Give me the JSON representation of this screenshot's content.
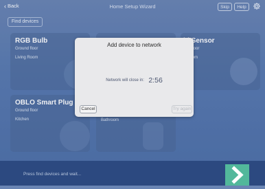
{
  "header": {
    "back_label": "Back",
    "title": "Home Setup Wizard",
    "skip_label": "Skip",
    "help_label": "Help"
  },
  "find_devices_label": "Find devices",
  "devices": [
    {
      "name": "RGB Bulb",
      "floor": "Ground floor",
      "room": "Living Room"
    },
    {
      "name": "lti Sensor",
      "floor": "und floor",
      "room": "g Room"
    },
    {
      "name": "OBLO Smart Plug",
      "floor": "Ground floor",
      "room": "Kitchen"
    },
    {
      "name": "",
      "floor": "",
      "room": "Bathroom"
    }
  ],
  "modal": {
    "title": "Add device to network",
    "countdown_label": "Network will close in:",
    "countdown_value": "2:56",
    "cancel_label": "Cancel",
    "retry_label": "Try again"
  },
  "footer": {
    "status_text": "Press find devices and wait..."
  },
  "colors": {
    "accent_green": "#52b89b",
    "background_blue": "#587ab0"
  }
}
